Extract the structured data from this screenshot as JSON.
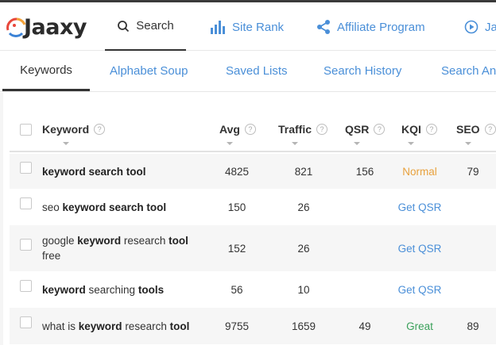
{
  "brand": {
    "logo_text": "Jaaxy"
  },
  "top_nav": [
    {
      "label": "Search",
      "icon": "search-icon",
      "active": true
    },
    {
      "label": "Site Rank",
      "icon": "bar-chart-icon",
      "active": false
    },
    {
      "label": "Affiliate Program",
      "icon": "share-icon",
      "active": false
    },
    {
      "label": "Ja",
      "icon": "play-circle-icon",
      "active": false
    }
  ],
  "sub_tabs": [
    {
      "label": "Keywords",
      "active": true
    },
    {
      "label": "Alphabet Soup",
      "active": false
    },
    {
      "label": "Saved Lists",
      "active": false
    },
    {
      "label": "Search History",
      "active": false
    },
    {
      "label": "Search Ana",
      "active": false
    }
  ],
  "table": {
    "headers": {
      "keyword": "Keyword",
      "avg": "Avg",
      "traffic": "Traffic",
      "qsr": "QSR",
      "kqi": "KQI",
      "seo": "SEO",
      "help_glyph": "?"
    },
    "rows": [
      {
        "keyword_parts": [
          [
            "keyword search tool",
            true
          ]
        ],
        "avg": "4825",
        "traffic": "821",
        "qsr": "156",
        "kqi": "Normal",
        "kqi_type": "normal",
        "seo": "79"
      },
      {
        "keyword_parts": [
          [
            "seo ",
            false
          ],
          [
            "keyword search tool",
            true
          ]
        ],
        "avg": "150",
        "traffic": "26",
        "qsr": "",
        "kqi": "Get QSR",
        "kqi_type": "link",
        "seo": ""
      },
      {
        "keyword_parts": [
          [
            "google ",
            false
          ],
          [
            "keyword",
            true
          ],
          [
            " research ",
            false
          ],
          [
            "tool",
            true
          ],
          [
            " free",
            false
          ]
        ],
        "avg": "152",
        "traffic": "26",
        "qsr": "",
        "kqi": "Get QSR",
        "kqi_type": "link",
        "seo": ""
      },
      {
        "keyword_parts": [
          [
            "keyword",
            true
          ],
          [
            " searching ",
            false
          ],
          [
            "tools",
            true
          ]
        ],
        "avg": "56",
        "traffic": "10",
        "qsr": "",
        "kqi": "Get QSR",
        "kqi_type": "link",
        "seo": ""
      },
      {
        "keyword_parts": [
          [
            "what is ",
            false
          ],
          [
            "keyword",
            true
          ],
          [
            " research ",
            false
          ],
          [
            "tool",
            true
          ]
        ],
        "avg": "9755",
        "traffic": "1659",
        "qsr": "49",
        "kqi": "Great",
        "kqi_type": "great",
        "seo": "89"
      }
    ]
  },
  "colors": {
    "link": "#4a8fd8",
    "kqi_normal": "#e8a13d",
    "kqi_great": "#3aa05a",
    "logo_red": "#e8473b",
    "logo_orange": "#f2a23a",
    "logo_blue": "#3b82d6"
  }
}
